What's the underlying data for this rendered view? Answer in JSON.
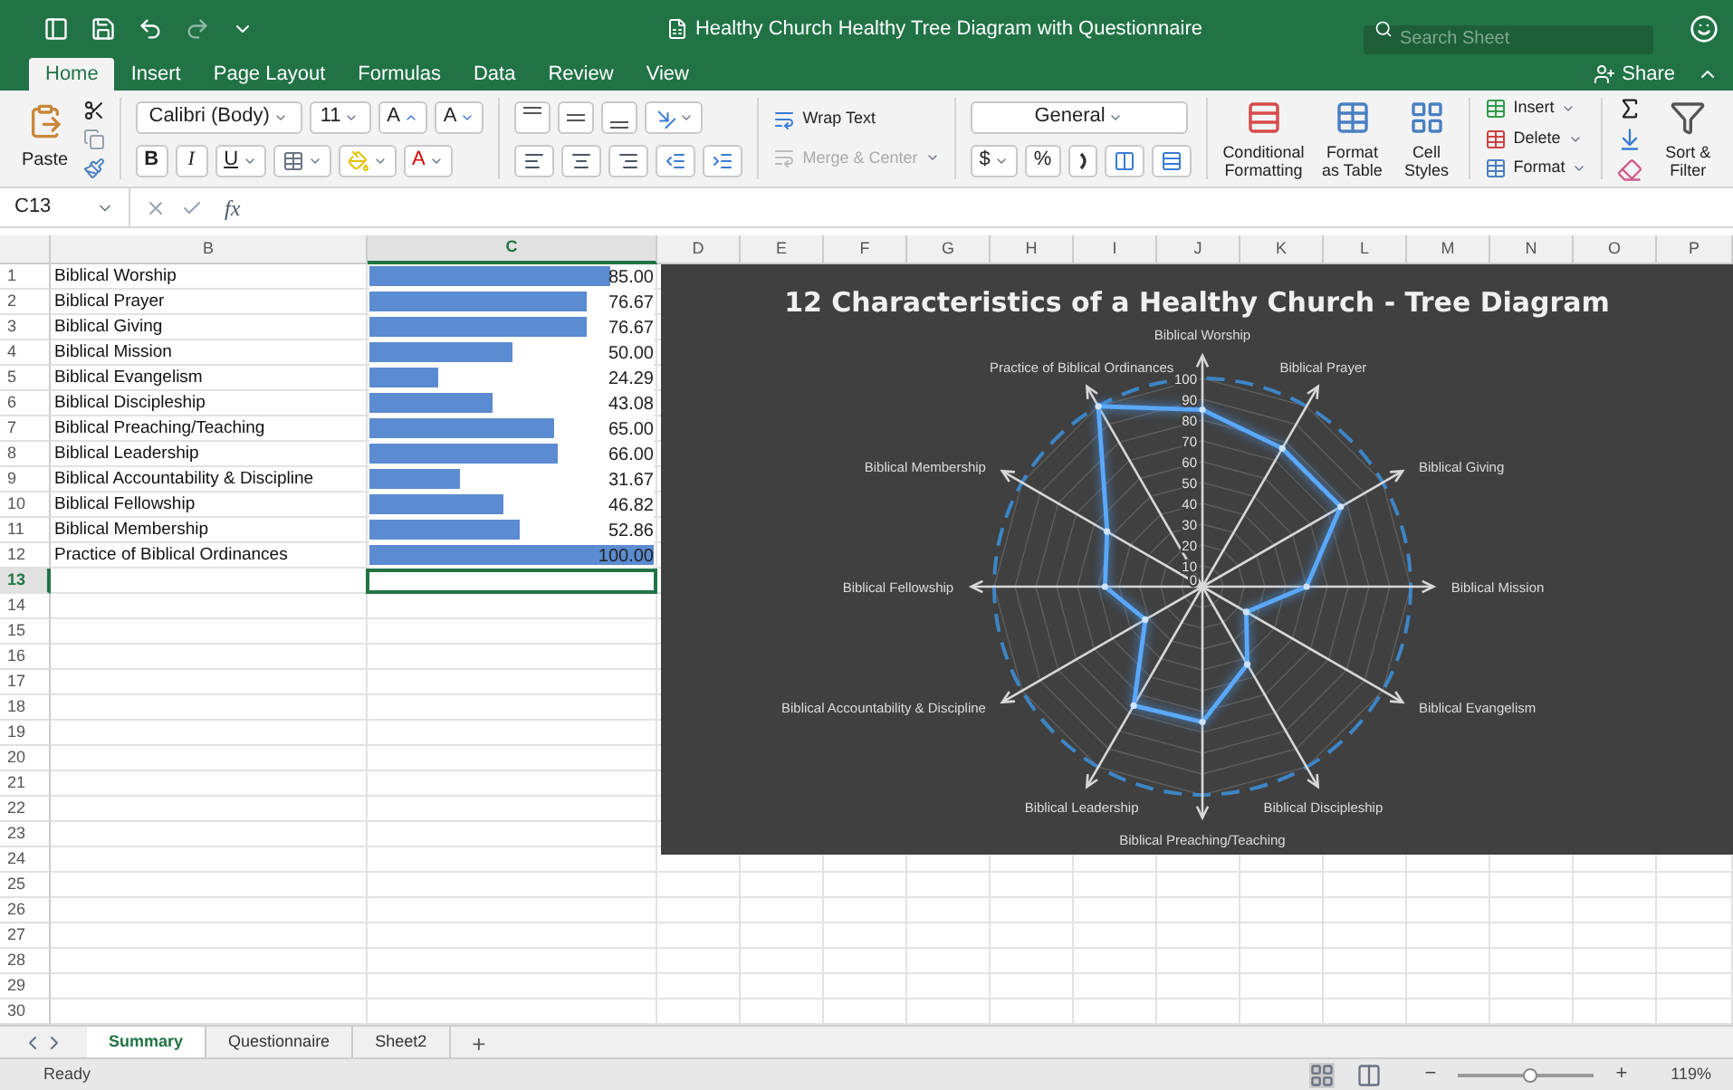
{
  "window": {
    "title": "Healthy Church Healthy Tree Diagram with Questionnaire",
    "search": {
      "placeholder": "Search Sheet"
    }
  },
  "tabs": [
    {
      "label": "Home",
      "selected": true
    },
    {
      "label": "Insert",
      "selected": false
    },
    {
      "label": "Page Layout",
      "selected": false
    },
    {
      "label": "Formulas",
      "selected": false
    },
    {
      "label": "Data",
      "selected": false
    },
    {
      "label": "Review",
      "selected": false
    },
    {
      "label": "View",
      "selected": false
    }
  ],
  "share": "Share",
  "ribbon": {
    "paste": "Paste",
    "font": "Calibri (Body)",
    "size": "11",
    "grow_font": "A",
    "shrink_font": "A",
    "bold": "B",
    "italic": "I",
    "underline": "U",
    "font_color": "A",
    "wrap_text": {
      "label": "Wrap Text",
      "disabled": false
    },
    "merge": {
      "label": "Merge & Center",
      "disabled": true
    },
    "number_format": "General",
    "currency": "$",
    "percent": "%",
    "conditional": "Conditional Formatting",
    "format_table": "Format as Table",
    "cell_styles": "Cell Styles",
    "insert": "Insert",
    "delete": "Delete",
    "format": "Format",
    "sort": "Sort & Filter"
  },
  "formula_bar": {
    "name_box": "C13",
    "fx": "fx"
  },
  "columns": [
    {
      "label": "B",
      "selected": false
    },
    {
      "label": "C",
      "selected": true
    },
    {
      "label": "D",
      "selected": false
    },
    {
      "label": "E",
      "selected": false
    },
    {
      "label": "F",
      "selected": false
    },
    {
      "label": "G",
      "selected": false
    },
    {
      "label": "H",
      "selected": false
    },
    {
      "label": "I",
      "selected": false
    },
    {
      "label": "J",
      "selected": false
    },
    {
      "label": "K",
      "selected": false
    },
    {
      "label": "L",
      "selected": false
    },
    {
      "label": "M",
      "selected": false
    },
    {
      "label": "N",
      "selected": false
    },
    {
      "label": "O",
      "selected": false
    },
    {
      "label": "P",
      "selected": false
    }
  ],
  "rows": [
    {
      "num": "1",
      "label": "Biblical Worship",
      "value": "85.00",
      "level": 0.85,
      "selected": false
    },
    {
      "num": "2",
      "label": "Biblical Prayer",
      "value": "76.67",
      "level": 0.7667,
      "selected": false
    },
    {
      "num": "3",
      "label": "Biblical Giving",
      "value": "76.67",
      "level": 0.7667,
      "selected": false
    },
    {
      "num": "4",
      "label": "Biblical Mission",
      "value": "50.00",
      "level": 0.5,
      "selected": false
    },
    {
      "num": "5",
      "label": "Biblical Evangelism",
      "value": "24.29",
      "level": 0.2429,
      "selected": false
    },
    {
      "num": "6",
      "label": "Biblical Discipleship",
      "value": "43.08",
      "level": 0.4308,
      "selected": false
    },
    {
      "num": "7",
      "label": "Biblical Preaching/Teaching",
      "value": "65.00",
      "level": 0.65,
      "selected": false
    },
    {
      "num": "8",
      "label": "Biblical Leadership",
      "value": "66.00",
      "level": 0.66,
      "selected": false
    },
    {
      "num": "9",
      "label": "Biblical Accountability & Discipline",
      "value": "31.67",
      "level": 0.3167,
      "selected": false
    },
    {
      "num": "10",
      "label": "Biblical Fellowship",
      "value": "46.82",
      "level": 0.4682,
      "selected": false
    },
    {
      "num": "11",
      "label": "Biblical Membership",
      "value": "52.86",
      "level": 0.5286,
      "selected": false
    },
    {
      "num": "12",
      "label": "Practice of Biblical Ordinances",
      "value": "100.00",
      "level": 1,
      "selected": false
    },
    {
      "num": "13",
      "selected": true
    },
    {
      "num": "14",
      "selected": false
    },
    {
      "num": "15",
      "selected": false
    },
    {
      "num": "16",
      "selected": false
    },
    {
      "num": "17",
      "selected": false
    },
    {
      "num": "18",
      "selected": false
    },
    {
      "num": "19",
      "selected": false
    },
    {
      "num": "20",
      "selected": false
    },
    {
      "num": "21",
      "selected": false
    },
    {
      "num": "22",
      "selected": false
    },
    {
      "num": "23",
      "selected": false
    },
    {
      "num": "24",
      "selected": false
    },
    {
      "num": "25",
      "selected": false
    },
    {
      "num": "26",
      "selected": false
    },
    {
      "num": "27",
      "selected": false
    },
    {
      "num": "28",
      "selected": false
    },
    {
      "num": "29",
      "selected": false
    },
    {
      "num": "30",
      "selected": false
    }
  ],
  "chart": {
    "chart_data": {
      "type": "radar",
      "title": "12 Characteristics of a Healthy Church - Tree Diagram",
      "categories": [
        "Biblical Worship",
        "Biblical Prayer",
        "Biblical Giving",
        "Biblical Mission",
        "Biblical Evangelism",
        "Biblical Discipleship",
        "Biblical Preaching/Teaching",
        "Biblical Leadership",
        "Biblical Accountability & Discipline",
        "Biblical Fellowship",
        "Biblical Membership",
        "Practice of Biblical Ordinances"
      ],
      "values": [
        85,
        76.67,
        76.67,
        50,
        24.29,
        43.08,
        65,
        66,
        31.67,
        46.82,
        52.86,
        100
      ],
      "ylim": [
        0,
        100
      ],
      "yticks": [
        0,
        10,
        20,
        30,
        40,
        50,
        60,
        70,
        80,
        90,
        100
      ]
    }
  },
  "sheet_tabs": [
    {
      "label": "Summary",
      "selected": true
    },
    {
      "label": "Questionnaire",
      "selected": false
    },
    {
      "label": "Sheet2",
      "selected": false
    }
  ],
  "add_sheet": "+",
  "status_bar": {
    "status": "Ready",
    "zoom_out": "−",
    "zoom_in": "+",
    "zoom": {
      "level": 0.53
    },
    "zoom_reading": "119%"
  }
}
